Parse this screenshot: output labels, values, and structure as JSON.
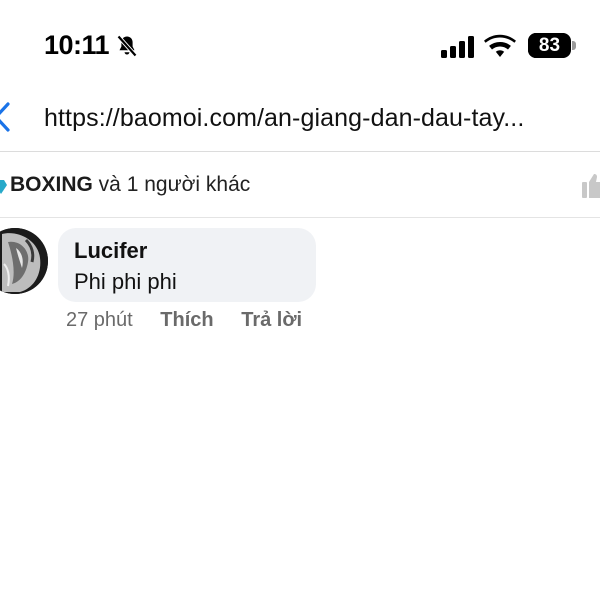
{
  "status_bar": {
    "time": "10:11",
    "battery_level": "83",
    "battery_percent": 83,
    "icons": [
      "bell-slash-icon",
      "signal-icon",
      "wifi-icon",
      "battery-icon"
    ]
  },
  "browser": {
    "url": "https://baomoi.com/an-giang-dan-dau-tay...",
    "back_icon": "chevron-left-icon",
    "accent_color": "#1a73e8"
  },
  "reactions": {
    "name": "BOXING",
    "rest": " và 1 người khác",
    "icon": "reaction-icon",
    "like_icon": "thumbs-up-icon"
  },
  "comment": {
    "author": "Lucifer",
    "text": "Phi phi phi",
    "time_ago": "27 phút",
    "like_label": "Thích",
    "reply_label": "Trả lời",
    "avatar_icon": "avatar"
  }
}
